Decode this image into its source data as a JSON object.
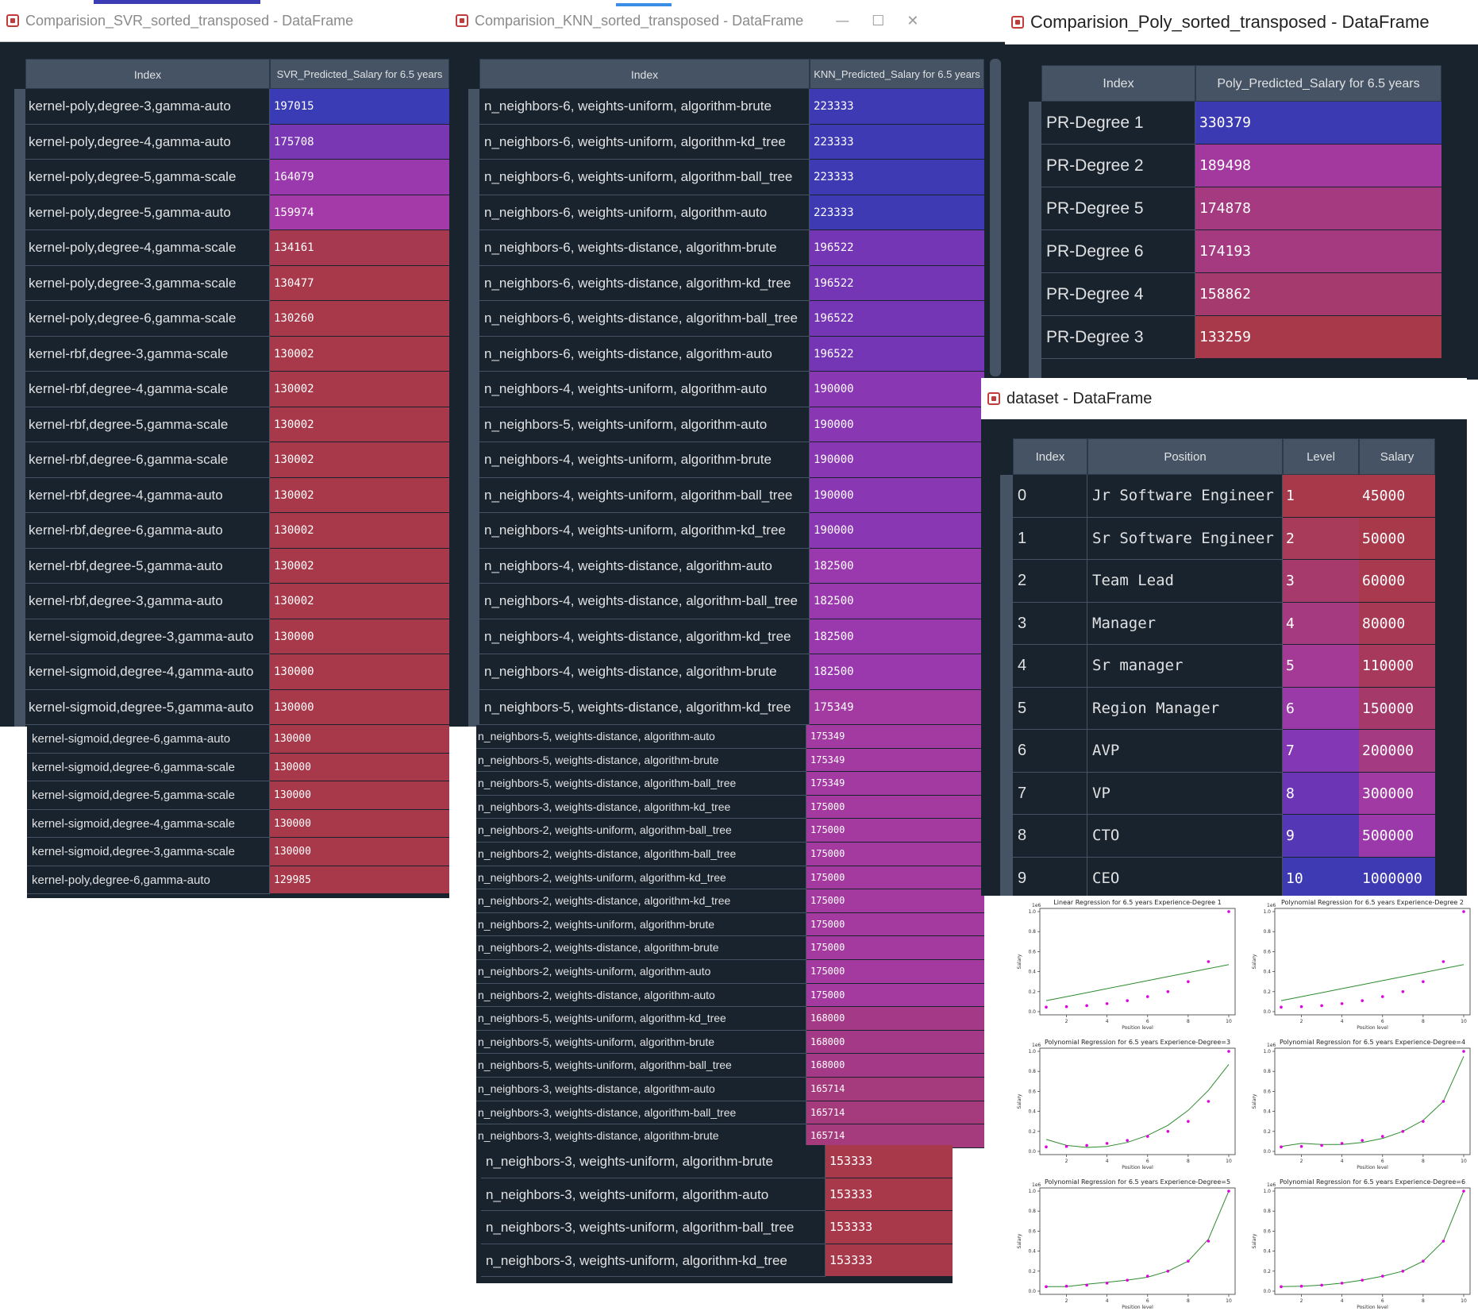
{
  "svr_window": {
    "title": "Comparision_SVR_sorted_transposed - DataFrame",
    "header_index": "Index",
    "header_value": "SVR_Predicted_Salary for 6.5 years",
    "rows": [
      {
        "index": "kernel-poly,degree-3,gamma-auto",
        "value": "197015",
        "color": "#3a3cb5"
      },
      {
        "index": "kernel-poly,degree-4,gamma-auto",
        "value": "175708",
        "color": "#7a37b4"
      },
      {
        "index": "kernel-poly,degree-5,gamma-scale",
        "value": "164079",
        "color": "#9a38ad"
      },
      {
        "index": "kernel-poly,degree-5,gamma-auto",
        "value": "159974",
        "color": "#a43aa8"
      },
      {
        "index": "kernel-poly,degree-4,gamma-scale",
        "value": "134161",
        "color": "#a6394f"
      },
      {
        "index": "kernel-poly,degree-3,gamma-scale",
        "value": "130477",
        "color": "#a8394a"
      },
      {
        "index": "kernel-poly,degree-6,gamma-scale",
        "value": "130260",
        "color": "#a8394a"
      },
      {
        "index": "kernel-rbf,degree-3,gamma-scale",
        "value": "130002",
        "color": "#a8394a"
      },
      {
        "index": "kernel-rbf,degree-4,gamma-scale",
        "value": "130002",
        "color": "#a8394a"
      },
      {
        "index": "kernel-rbf,degree-5,gamma-scale",
        "value": "130002",
        "color": "#a8394a"
      },
      {
        "index": "kernel-rbf,degree-6,gamma-scale",
        "value": "130002",
        "color": "#a8394a"
      },
      {
        "index": "kernel-rbf,degree-4,gamma-auto",
        "value": "130002",
        "color": "#a8394a"
      },
      {
        "index": "kernel-rbf,degree-6,gamma-auto",
        "value": "130002",
        "color": "#a8394a"
      },
      {
        "index": "kernel-rbf,degree-5,gamma-auto",
        "value": "130002",
        "color": "#a8394a"
      },
      {
        "index": "kernel-rbf,degree-3,gamma-auto",
        "value": "130002",
        "color": "#a8394a"
      },
      {
        "index": "kernel-sigmoid,degree-3,gamma-auto",
        "value": "130000",
        "color": "#a8394a"
      },
      {
        "index": "kernel-sigmoid,degree-4,gamma-auto",
        "value": "130000",
        "color": "#a8394a"
      },
      {
        "index": "kernel-sigmoid,degree-5,gamma-auto",
        "value": "130000",
        "color": "#a8394a"
      }
    ],
    "extra_rows": [
      {
        "index": "kernel-sigmoid,degree-6,gamma-auto",
        "value": "130000"
      },
      {
        "index": "kernel-sigmoid,degree-6,gamma-scale",
        "value": "130000"
      },
      {
        "index": "kernel-sigmoid,degree-5,gamma-scale",
        "value": "130000"
      },
      {
        "index": "kernel-sigmoid,degree-4,gamma-scale",
        "value": "130000"
      },
      {
        "index": "kernel-sigmoid,degree-3,gamma-scale",
        "value": "130000"
      },
      {
        "index": "kernel-poly,degree-6,gamma-auto",
        "value": "129985"
      }
    ]
  },
  "knn_window": {
    "title": "Comparision_KNN_sorted_transposed - DataFrame",
    "header_index": "Index",
    "header_value": "KNN_Predicted_Salary for 6.5 years",
    "rows": [
      {
        "index": "n_neighbors-6, weights-uniform, algorithm-brute",
        "value": "223333",
        "color": "#3d3ab3"
      },
      {
        "index": "n_neighbors-6, weights-uniform, algorithm-kd_tree",
        "value": "223333",
        "color": "#3d3ab3"
      },
      {
        "index": "n_neighbors-6, weights-uniform, algorithm-ball_tree",
        "value": "223333",
        "color": "#3d3ab3"
      },
      {
        "index": "n_neighbors-6, weights-uniform, algorithm-auto",
        "value": "223333",
        "color": "#3d3ab3"
      },
      {
        "index": "n_neighbors-6, weights-distance, algorithm-brute",
        "value": "196522",
        "color": "#7536b5"
      },
      {
        "index": "n_neighbors-6, weights-distance, algorithm-kd_tree",
        "value": "196522",
        "color": "#7536b5"
      },
      {
        "index": "n_neighbors-6, weights-distance, algorithm-ball_tree",
        "value": "196522",
        "color": "#7536b5"
      },
      {
        "index": "n_neighbors-6, weights-distance, algorithm-auto",
        "value": "196522",
        "color": "#7536b5"
      },
      {
        "index": "n_neighbors-4, weights-uniform, algorithm-auto",
        "value": "190000",
        "color": "#8a37b3"
      },
      {
        "index": "n_neighbors-5, weights-uniform, algorithm-auto",
        "value": "190000",
        "color": "#8a37b3"
      },
      {
        "index": "n_neighbors-4, weights-uniform, algorithm-brute",
        "value": "190000",
        "color": "#8a37b3"
      },
      {
        "index": "n_neighbors-4, weights-uniform, algorithm-ball_tree",
        "value": "190000",
        "color": "#8a37b3"
      },
      {
        "index": "n_neighbors-4, weights-uniform, algorithm-kd_tree",
        "value": "190000",
        "color": "#8a37b3"
      },
      {
        "index": "n_neighbors-4, weights-distance, algorithm-auto",
        "value": "182500",
        "color": "#9a39ad"
      },
      {
        "index": "n_neighbors-4, weights-distance, algorithm-ball_tree",
        "value": "182500",
        "color": "#9a39ad"
      },
      {
        "index": "n_neighbors-4, weights-distance, algorithm-kd_tree",
        "value": "182500",
        "color": "#9a39ad"
      },
      {
        "index": "n_neighbors-4, weights-distance, algorithm-brute",
        "value": "182500",
        "color": "#9a39ad"
      },
      {
        "index": "n_neighbors-5, weights-distance, algorithm-kd_tree",
        "value": "175349",
        "color": "#a33aa2"
      }
    ],
    "extra_rows": [
      {
        "index": "n_neighbors-5, weights-distance, algorithm-auto",
        "value": "175349",
        "color": "#a33aa2"
      },
      {
        "index": "n_neighbors-5, weights-distance, algorithm-brute",
        "value": "175349",
        "color": "#a33aa2"
      },
      {
        "index": "n_neighbors-5, weights-distance, algorithm-ball_tree",
        "value": "175349",
        "color": "#a33aa2"
      },
      {
        "index": "n_neighbors-3, weights-distance, algorithm-kd_tree",
        "value": "175000",
        "color": "#a43aa0"
      },
      {
        "index": "n_neighbors-2, weights-uniform, algorithm-ball_tree",
        "value": "175000",
        "color": "#a43aa0"
      },
      {
        "index": "n_neighbors-2, weights-distance, algorithm-ball_tree",
        "value": "175000",
        "color": "#a43aa0"
      },
      {
        "index": "n_neighbors-2, weights-uniform, algorithm-kd_tree",
        "value": "175000",
        "color": "#a43aa0"
      },
      {
        "index": "n_neighbors-2, weights-distance, algorithm-kd_tree",
        "value": "175000",
        "color": "#a43aa0"
      },
      {
        "index": "n_neighbors-2, weights-uniform, algorithm-brute",
        "value": "175000",
        "color": "#a43aa0"
      },
      {
        "index": "n_neighbors-2, weights-distance, algorithm-brute",
        "value": "175000",
        "color": "#a43aa0"
      },
      {
        "index": "n_neighbors-2, weights-uniform, algorithm-auto",
        "value": "175000",
        "color": "#a43aa0"
      },
      {
        "index": "n_neighbors-2, weights-distance, algorithm-auto",
        "value": "175000",
        "color": "#a43aa0"
      },
      {
        "index": "n_neighbors-5, weights-uniform, algorithm-kd_tree",
        "value": "168000",
        "color": "#a43a87"
      },
      {
        "index": "n_neighbors-5, weights-uniform, algorithm-brute",
        "value": "168000",
        "color": "#a43a87"
      },
      {
        "index": "n_neighbors-5, weights-uniform, algorithm-ball_tree",
        "value": "168000",
        "color": "#a43a87"
      },
      {
        "index": "n_neighbors-3, weights-distance, algorithm-auto",
        "value": "165714",
        "color": "#a53a7c"
      },
      {
        "index": "n_neighbors-3, weights-distance, algorithm-ball_tree",
        "value": "165714",
        "color": "#a53a7c"
      },
      {
        "index": "n_neighbors-3, weights-distance, algorithm-brute",
        "value": "165714",
        "color": "#a53a7c"
      }
    ],
    "bottom_rows": [
      {
        "index": "n_neighbors-3, weights-uniform, algorithm-brute",
        "value": "153333"
      },
      {
        "index": "n_neighbors-3, weights-uniform, algorithm-auto",
        "value": "153333"
      },
      {
        "index": "n_neighbors-3, weights-uniform, algorithm-ball_tree",
        "value": "153333"
      },
      {
        "index": "n_neighbors-3, weights-uniform, algorithm-kd_tree",
        "value": "153333"
      }
    ]
  },
  "poly_window": {
    "title": "Comparision_Poly_sorted_transposed - DataFrame",
    "header_index": "Index",
    "header_value": "Poly_Predicted_Salary for 6.5 years",
    "rows": [
      {
        "index": "PR-Degree 1",
        "value": "330379",
        "color": "#3b3ab3"
      },
      {
        "index": "PR-Degree 2",
        "value": "189498",
        "color": "#a3399f"
      },
      {
        "index": "PR-Degree 5",
        "value": "174878",
        "color": "#a53a80"
      },
      {
        "index": "PR-Degree 6",
        "value": "174193",
        "color": "#a53a80"
      },
      {
        "index": "PR-Degree 4",
        "value": "158862",
        "color": "#a43a6e"
      },
      {
        "index": "PR-Degree 3",
        "value": "133259",
        "color": "#a8394a"
      }
    ]
  },
  "dataset_window": {
    "title": "dataset - DataFrame",
    "headers": [
      "Index",
      "Position",
      "Level",
      "Salary"
    ],
    "rows": [
      {
        "index": "0",
        "position": "Jr Software Engineer",
        "level": "1",
        "salary": "45000",
        "level_color": "#a8394a",
        "salary_color": "#a8394a"
      },
      {
        "index": "1",
        "position": "Sr Software Engineer",
        "level": "2",
        "salary": "50000",
        "level_color": "#a83a5a",
        "salary_color": "#a8394b"
      },
      {
        "index": "2",
        "position": "Team Lead",
        "level": "3",
        "salary": "60000",
        "level_color": "#a73a6c",
        "salary_color": "#a8394e"
      },
      {
        "index": "3",
        "position": "Manager",
        "level": "4",
        "salary": "80000",
        "level_color": "#a63a80",
        "salary_color": "#a83954"
      },
      {
        "index": "4",
        "position": "Sr manager",
        "level": "5",
        "salary": "110000",
        "level_color": "#a43a95",
        "salary_color": "#a73a5c"
      },
      {
        "index": "5",
        "position": "Region Manager",
        "level": "6",
        "salary": "150000",
        "level_color": "#9a39a8",
        "salary_color": "#a53a6a"
      },
      {
        "index": "6",
        "position": "AVP",
        "level": "7",
        "salary": "200000",
        "level_color": "#8437b4",
        "salary_color": "#a43a82"
      },
      {
        "index": "7",
        "position": "VP",
        "level": "8",
        "salary": "300000",
        "level_color": "#6c35b6",
        "salary_color": "#a13aa3"
      },
      {
        "index": "8",
        "position": "CTO",
        "level": "9",
        "salary": "500000",
        "level_color": "#5437b5",
        "salary_color": "#9b38aa"
      },
      {
        "index": "9",
        "position": "CEO",
        "level": "10",
        "salary": "1000000",
        "level_color": "#3d3ab3",
        "salary_color": "#3d3ab3"
      }
    ]
  },
  "chart_data": [
    {
      "type": "scatter",
      "title": "Linear Regression for 6.5 years Experience-Degree  1",
      "xlabel": "Position level",
      "ylabel": "Salary",
      "x": [
        1,
        2,
        3,
        4,
        5,
        6,
        7,
        8,
        9,
        10
      ],
      "y": [
        0.045,
        0.05,
        0.06,
        0.08,
        0.11,
        0.15,
        0.2,
        0.3,
        0.5,
        1.0
      ],
      "fit": [
        0.11,
        0.15,
        0.19,
        0.23,
        0.27,
        0.31,
        0.35,
        0.39,
        0.43,
        0.47
      ],
      "ylim": [
        0,
        1
      ],
      "xlim": [
        1,
        10
      ]
    },
    {
      "type": "scatter",
      "title": "Polynomial Regression for 6.5 years Experience-Degree  2",
      "xlabel": "Position level",
      "ylabel": "Salary",
      "x": [
        1,
        2,
        3,
        4,
        5,
        6,
        7,
        8,
        9,
        10
      ],
      "y": [
        0.045,
        0.05,
        0.06,
        0.08,
        0.11,
        0.15,
        0.2,
        0.3,
        0.5,
        1.0
      ],
      "fit": [
        0.11,
        0.15,
        0.19,
        0.23,
        0.27,
        0.31,
        0.35,
        0.39,
        0.43,
        0.47
      ],
      "ylim": [
        0,
        1
      ],
      "xlim": [
        1,
        10
      ]
    },
    {
      "type": "scatter",
      "title": "Polynomial Regression for 6.5 years Experience-Degree=3",
      "xlabel": "Position level",
      "ylabel": "Salary",
      "x": [
        1,
        2,
        3,
        4,
        5,
        6,
        7,
        8,
        9,
        10
      ],
      "y": [
        0.045,
        0.05,
        0.06,
        0.08,
        0.11,
        0.15,
        0.2,
        0.3,
        0.5,
        1.0
      ],
      "fit": [
        0.12,
        0.06,
        0.04,
        0.05,
        0.09,
        0.16,
        0.26,
        0.41,
        0.61,
        0.87
      ],
      "ylim": [
        0,
        1
      ],
      "xlim": [
        1,
        10
      ]
    },
    {
      "type": "scatter",
      "title": "Polynomial Regression for 6.5 years Experience-Degree=4",
      "xlabel": "Position level",
      "ylabel": "Salary",
      "x": [
        1,
        2,
        3,
        4,
        5,
        6,
        7,
        8,
        9,
        10
      ],
      "y": [
        0.045,
        0.05,
        0.06,
        0.08,
        0.11,
        0.15,
        0.2,
        0.3,
        0.5,
        1.0
      ],
      "fit": [
        0.05,
        0.08,
        0.07,
        0.07,
        0.09,
        0.13,
        0.2,
        0.31,
        0.5,
        0.95
      ],
      "ylim": [
        0,
        1
      ],
      "xlim": [
        1,
        10
      ]
    },
    {
      "type": "scatter",
      "title": "Polynomial Regression for 6.5 years Experience-Degree=5",
      "xlabel": "Position level",
      "ylabel": "Salary",
      "x": [
        1,
        2,
        3,
        4,
        5,
        6,
        7,
        8,
        9,
        10
      ],
      "y": [
        0.045,
        0.05,
        0.06,
        0.08,
        0.11,
        0.15,
        0.2,
        0.3,
        0.5,
        1.0
      ],
      "fit": [
        0.045,
        0.045,
        0.07,
        0.09,
        0.11,
        0.14,
        0.2,
        0.3,
        0.52,
        1.0
      ],
      "ylim": [
        0,
        1
      ],
      "xlim": [
        1,
        10
      ]
    },
    {
      "type": "scatter",
      "title": "Polynomial Regression for 6.5 years Experience-Degree=6",
      "xlabel": "Position level",
      "ylabel": "Salary",
      "x": [
        1,
        2,
        3,
        4,
        5,
        6,
        7,
        8,
        9,
        10
      ],
      "y": [
        0.045,
        0.05,
        0.06,
        0.08,
        0.11,
        0.15,
        0.2,
        0.3,
        0.5,
        1.0
      ],
      "fit": [
        0.045,
        0.05,
        0.06,
        0.08,
        0.11,
        0.15,
        0.2,
        0.3,
        0.5,
        1.0
      ],
      "ylim": [
        0,
        1
      ],
      "xlim": [
        1,
        10
      ]
    }
  ],
  "chart_meta": {
    "exponent_label": "1e6",
    "yticks": [
      "0.0",
      "0.2",
      "0.4",
      "0.6",
      "0.8",
      "1.0"
    ],
    "xticks": [
      "2",
      "4",
      "6",
      "8",
      "10"
    ],
    "line_color": "#2e8b2e",
    "point_color": "#e000e0"
  }
}
